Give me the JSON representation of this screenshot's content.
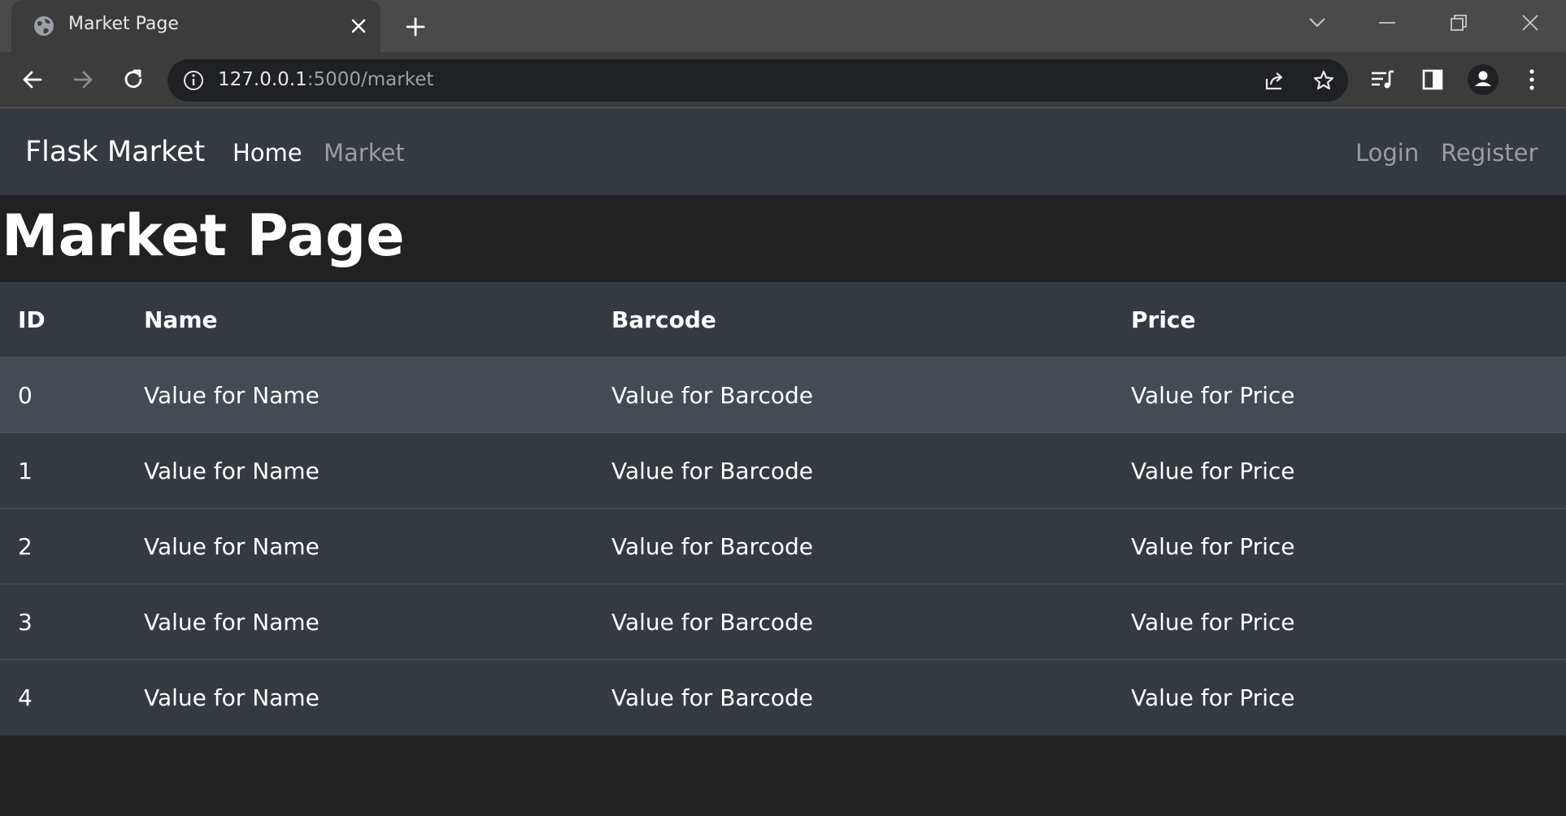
{
  "browser": {
    "tab": {
      "title": "Market Page"
    },
    "url": {
      "host": "127.0.0.1",
      "path": ":5000/market"
    }
  },
  "navbar": {
    "brand": "Flask Market",
    "links": [
      {
        "label": "Home",
        "active": true
      },
      {
        "label": "Market",
        "active": false
      }
    ],
    "auth": [
      {
        "label": "Login"
      },
      {
        "label": "Register"
      }
    ]
  },
  "page": {
    "heading": "Market Page"
  },
  "table": {
    "headers": [
      "ID",
      "Name",
      "Barcode",
      "Price"
    ],
    "rows": [
      [
        "0",
        "Value for Name",
        "Value for Barcode",
        "Value for Price"
      ],
      [
        "1",
        "Value for Name",
        "Value for Barcode",
        "Value for Price"
      ],
      [
        "2",
        "Value for Name",
        "Value for Barcode",
        "Value for Price"
      ],
      [
        "3",
        "Value for Name",
        "Value for Barcode",
        "Value for Price"
      ],
      [
        "4",
        "Value for Name",
        "Value for Barcode",
        "Value for Price"
      ]
    ]
  },
  "colors": {
    "navbar_bg": "#343a40",
    "page_bg": "#212121",
    "row_hover_bg": "#444b53"
  }
}
